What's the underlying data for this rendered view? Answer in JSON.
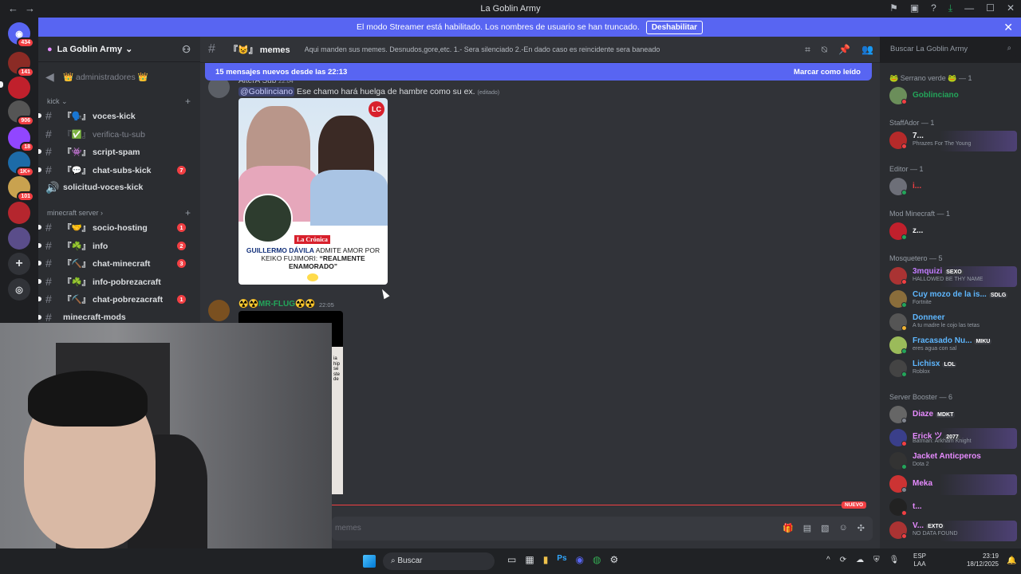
{
  "window": {
    "title": "La Goblin Army",
    "back": "←",
    "forward": "→"
  },
  "banner": {
    "text": "El modo Streamer está habilitado. Los nombres de usuario se han truncado.",
    "button": "Deshabilitar",
    "close": "✕"
  },
  "servers": [
    {
      "badge": "434"
    },
    {
      "badge": "141"
    },
    {
      "badge": ""
    },
    {
      "badge": "906"
    },
    {
      "badge": "18"
    },
    {
      "badge": "1K+"
    },
    {
      "badge": "101"
    },
    {
      "badge": ""
    },
    {
      "badge": ""
    }
  ],
  "server": {
    "name": "La Goblin Army",
    "chevron": "⌄"
  },
  "channels": {
    "top": {
      "name": "👑 administradores 👑"
    },
    "cat_kick": "kick",
    "kick": [
      {
        "name": "『🗣️』 voces-kick",
        "badge": ""
      },
      {
        "name": "『✅』 verifica-tu-sub",
        "badge": ""
      },
      {
        "name": "『👾』 script-spam",
        "badge": ""
      },
      {
        "name": "『💬』 chat-subs-kick",
        "badge": "7"
      },
      {
        "name": "solicitud-voces-kick",
        "badge": ""
      }
    ],
    "cat_minecraft": "minecraft server",
    "minecraft": [
      {
        "name": "『🤝』 socio-hosting",
        "badge": "1"
      },
      {
        "name": "『☘️』 info",
        "badge": "2"
      },
      {
        "name": "『⛏️』 chat-minecraft",
        "badge": "3"
      },
      {
        "name": "『☘️』 info-pobrezacraft",
        "badge": ""
      },
      {
        "name": "『⛏️』 chat-pobrezacraft",
        "badge": "1"
      },
      {
        "name": "minecraft-mods",
        "badge": ""
      }
    ]
  },
  "chat_header": {
    "channel": "『😺』 memes",
    "topic": "Aqui manden sus memes. Desnudos,gore,etc. 1.- Sera silenciado 2.-En dado caso es reincidente sera baneado"
  },
  "search": {
    "placeholder": "Buscar La Goblin Army"
  },
  "new_messages": {
    "text": "15 mensajes nuevos desde las 22:13",
    "mark": "Marcar como leído"
  },
  "message1": {
    "author": "AlterA Sub",
    "time": "22:04",
    "mention": "@Goblinciano",
    "text": "Ese chamo hará huelga de hambre como su ex.",
    "edited": "(editado)"
  },
  "news_image": {
    "logo": "LC",
    "brand": "La Crónica",
    "headline_name": "GUILLERMO DÁVILA",
    "headline_mid": " ADMITE AMOR POR KEIKO FUJIMORI: ",
    "headline_quote": "“REALMENTE ENAMORADO”"
  },
  "message2": {
    "author": "☢️☢️MR-FLUG☢️☢️",
    "time": "22:05"
  },
  "video_strip": "ia hip se ste de",
  "new_divider": "NUEVO",
  "input": {
    "placeholder": "memes"
  },
  "members": {
    "roles": [
      {
        "label": "🐸 Serrano verde 🐸 — 1"
      },
      {
        "label": "StaffAdor — 1"
      },
      {
        "label": "Editor — 1"
      },
      {
        "label": "Mod Minecraft — 1"
      },
      {
        "label": "Mosquetero — 5"
      },
      {
        "label": "Server Booster — 6"
      }
    ],
    "list": [
      {
        "name": "Goblinciano",
        "activity": "",
        "tag": "",
        "color": "#23a55a"
      },
      {
        "name": "7...",
        "activity": "Phrazes For The Young",
        "tag": "",
        "color": "#f2f3f5"
      },
      {
        "name": "i...",
        "activity": "",
        "tag": "",
        "color": "#f23f43"
      },
      {
        "name": "z...",
        "activity": "",
        "tag": "",
        "color": "#f2f3f5"
      },
      {
        "name": "3mquizi",
        "activity": "HALLOWED BE THY NAME",
        "tag": "SEXO",
        "color": "#c27cff"
      },
      {
        "name": "Cuy mozo de la is...",
        "activity": "Fortnite",
        "tag": "SDLG",
        "color": "#5eb7ff"
      },
      {
        "name": "Donneer",
        "activity": "A tu madre le cojo las tetas",
        "tag": "",
        "color": "#5eb7ff"
      },
      {
        "name": "Fracasado Nu...",
        "activity": "eres agua con sal",
        "tag": "MIKU",
        "color": "#5eb7ff"
      },
      {
        "name": "Lichisx",
        "activity": "Roblox",
        "tag": "LOL",
        "color": "#5eb7ff"
      },
      {
        "name": "Diaze",
        "activity": "",
        "tag": "MDKT",
        "color": "#e78bff"
      },
      {
        "name": "Erick ツ",
        "activity": "Batman: Arkham Knight",
        "tag": "2077",
        "color": "#e78bff"
      },
      {
        "name": "Jacket Anticperos",
        "activity": "Dota 2",
        "tag": "",
        "color": "#e78bff"
      },
      {
        "name": "Meka",
        "activity": "",
        "tag": "",
        "color": "#e78bff"
      },
      {
        "name": "t...",
        "activity": "",
        "tag": "",
        "color": "#e78bff"
      },
      {
        "name": "V...",
        "activity": "NO DATA FOUND",
        "tag": "EXTO",
        "color": "#e78bff"
      }
    ]
  },
  "taskbar": {
    "search": "Buscar",
    "lang1": "ESP",
    "lang2": "LAA",
    "time": "23:19",
    "date": "18/12/2025"
  }
}
